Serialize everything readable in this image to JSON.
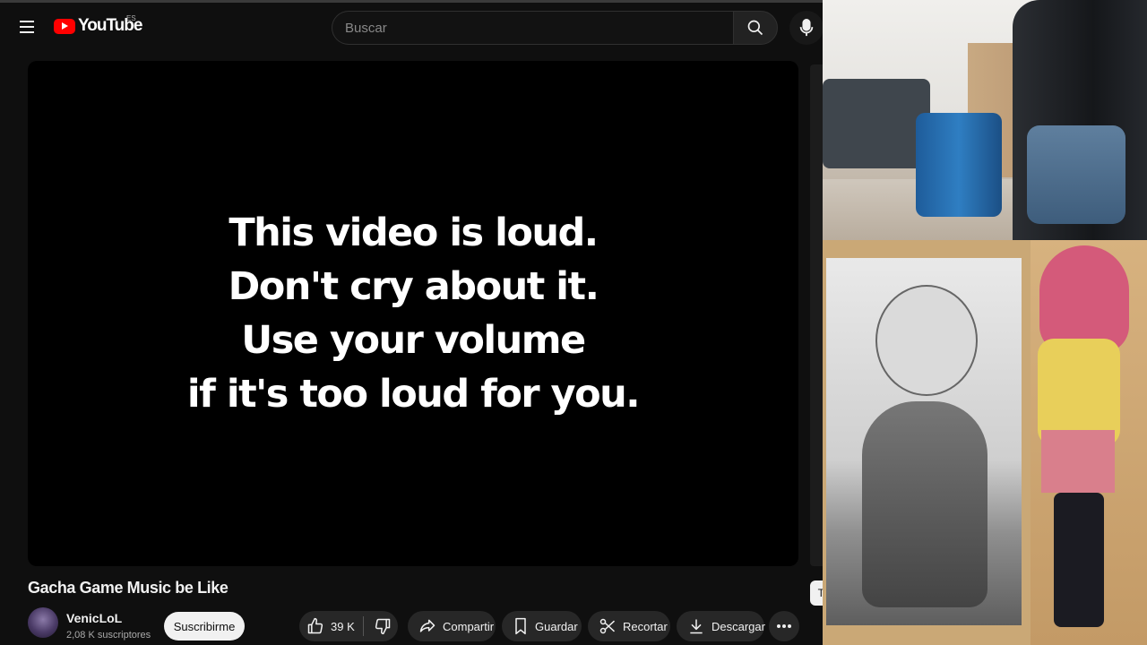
{
  "app": {
    "logo_text": "YouTube",
    "logo_region": "ES"
  },
  "search": {
    "placeholder": "Buscar"
  },
  "icons": {
    "menu": "menu-icon",
    "search": "search-icon",
    "mic": "mic-icon",
    "like": "thumbs-up-icon",
    "dislike": "thumbs-down-icon",
    "share": "share-icon",
    "save": "bookmark-icon",
    "clip": "scissors-icon",
    "download": "download-icon",
    "more": "more-horizontal-icon"
  },
  "player": {
    "slide_lines": [
      "This video is loud.",
      "Don't cry about it.",
      "Use your volume",
      "if it's too loud for you."
    ]
  },
  "video": {
    "title": "Gacha Game Music be Like"
  },
  "channel": {
    "name": "VenicLoL",
    "subscribers": "2,08 K suscriptores",
    "subscribe_label": "Suscribirme"
  },
  "actions": {
    "like_count": "39 K",
    "share_label": "Compartir",
    "save_label": "Guardar",
    "clip_label": "Recortar",
    "download_label": "Descargar"
  },
  "overlay": {
    "tab_peek_text": "T"
  },
  "colors": {
    "background": "#0f0f0f",
    "brand_red": "#ff0000",
    "pill_bg": "#272727",
    "subscribe_bg": "#f1f1f1"
  }
}
